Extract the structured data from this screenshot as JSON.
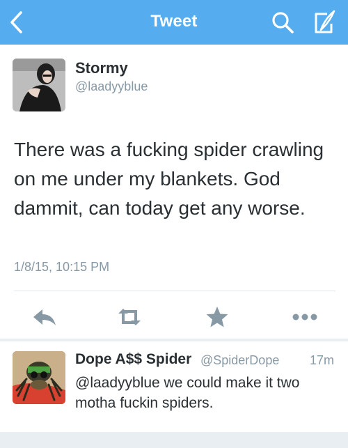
{
  "topbar": {
    "title": "Tweet",
    "background": "#55acee",
    "icons": [
      "chevron-left-icon",
      "search-icon",
      "compose-icon"
    ]
  },
  "tweet": {
    "author_name": "Stormy",
    "author_handle": "@laadyyblue",
    "text": "There was a fucking spider crawling on me under my blankets. God dammit, can today get any worse.",
    "timestamp": "1/8/15, 10:15 PM"
  },
  "actions": [
    "reply-icon",
    "retweet-icon",
    "favorite-icon",
    "more-icon"
  ],
  "reply": {
    "author_name": "Dope A$$ Spider",
    "author_handle": "@SpiderDope",
    "time": "17m",
    "text": "@laadyyblue we could make it two motha fuckin spiders."
  },
  "colors": {
    "accent": "#55acee",
    "text": "#292f33",
    "muted": "#8899a6",
    "icon": "#8899a6"
  }
}
